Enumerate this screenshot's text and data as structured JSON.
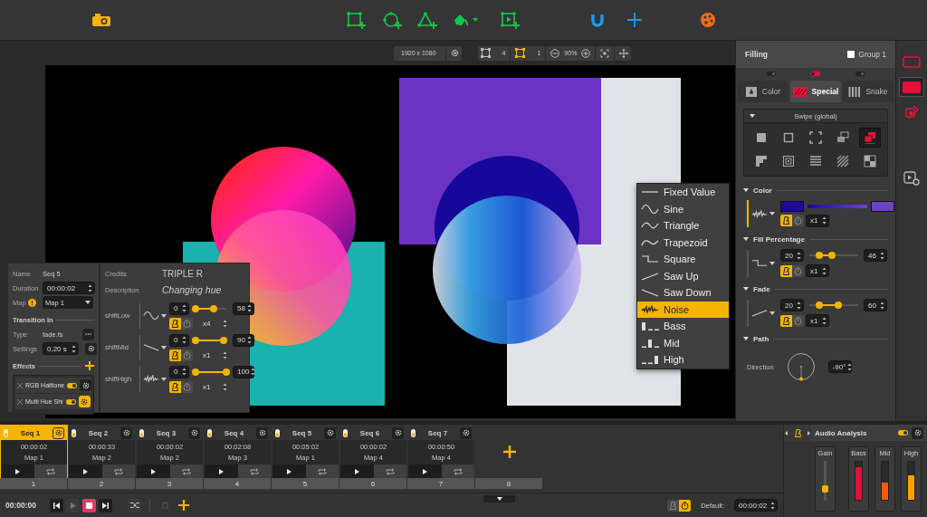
{
  "canvas_bar": {
    "resolution": "1920 x 1080",
    "shape_count": "4",
    "selected_count": "1",
    "zoom": "90%"
  },
  "sequence_panel": {
    "name_label": "Name",
    "name": "Seq 5",
    "duration_label": "Duration",
    "duration": "00:00:02",
    "map_label": "Map",
    "map": "Map 1",
    "transition_heading": "Transition In",
    "type_label": "Type",
    "type": "fade.fs",
    "settings_label": "Settings",
    "settings": "0,20 s",
    "effects_heading": "Effects",
    "effects": [
      {
        "name": "RGB Halftone",
        "on": true,
        "selected": false
      },
      {
        "name": "Multi Hue Shi",
        "on": true,
        "selected": true
      }
    ]
  },
  "effect_panel": {
    "credits_label": "Credits",
    "credits": "TRIPLE R",
    "description_label": "Description",
    "description": "Changing hue",
    "params": [
      {
        "name": "shiftLow",
        "wave": {
          "kind": "sine"
        },
        "min": "0",
        "max": "58",
        "thumbs": [
          {
            "level": 0
          },
          {
            "level": 0.58
          }
        ],
        "beat": true,
        "multiplier": "x4"
      },
      {
        "name": "shiftMid",
        "wave": {
          "kind": "saw_down"
        },
        "min": "0",
        "max": "90",
        "thumbs": [
          {
            "level": 0
          },
          {
            "level": 0.9
          }
        ],
        "beat": true,
        "multiplier": "x1"
      },
      {
        "name": "shiftHigh",
        "wave": {
          "kind": "noise"
        },
        "min": "0",
        "max": "100",
        "thumbs": [
          {
            "level": 0
          },
          {
            "level": 1
          }
        ],
        "beat": true,
        "multiplier": "x1"
      }
    ]
  },
  "wave_menu": [
    {
      "label": "Fixed Value",
      "kind": "fixed",
      "selected": false
    },
    {
      "label": "Sine",
      "kind": "sine",
      "selected": false
    },
    {
      "label": "Triangle",
      "kind": "triangle",
      "selected": false
    },
    {
      "label": "Trapezoid",
      "kind": "trapezoid",
      "selected": false
    },
    {
      "label": "Square",
      "kind": "square",
      "selected": false
    },
    {
      "label": "Saw Up",
      "kind": "saw_up",
      "selected": false
    },
    {
      "label": "Saw Down",
      "kind": "saw_down",
      "selected": false
    },
    {
      "label": "Noise",
      "kind": "noise",
      "selected": true
    },
    {
      "label": "Bass",
      "kind": "bass",
      "selected": false
    },
    {
      "label": "Mid",
      "kind": "mid",
      "selected": false
    },
    {
      "label": "High",
      "kind": "high",
      "selected": false
    }
  ],
  "filling_panel": {
    "title": "Filling",
    "group": {
      "label": "Group 1",
      "checked": false
    },
    "page_dots": [
      {
        "selected": false
      },
      {
        "selected": true
      },
      {
        "selected": false
      }
    ],
    "tabs": [
      {
        "label": "Color",
        "kind": "color",
        "selected": false
      },
      {
        "label": "Special",
        "kind": "special",
        "selected": true
      },
      {
        "label": "Snake",
        "kind": "snake",
        "selected": false
      }
    ],
    "preset": "Swipe (global)",
    "presets": [
      {
        "kind": "solid",
        "selected": false
      },
      {
        "kind": "outline",
        "selected": false
      },
      {
        "kind": "corners",
        "selected": false
      },
      {
        "kind": "overlap",
        "selected": false
      },
      {
        "kind": "swipe",
        "selected": true
      },
      {
        "kind": "stairs",
        "selected": false
      },
      {
        "kind": "concentric",
        "selected": false
      },
      {
        "kind": "lines",
        "selected": false
      },
      {
        "kind": "hatch",
        "selected": false
      },
      {
        "kind": "checker",
        "selected": false
      }
    ],
    "sections": [
      {
        "title": "Color",
        "kind": "color",
        "selected": true,
        "wave": {
          "kind": "noise"
        },
        "colors": [
          {
            "color": "#1c0a9c"
          },
          {
            "color": "#6b44c6"
          }
        ],
        "beat": true,
        "multiplier": "x1"
      },
      {
        "title": "Fill Percentage",
        "kind": "range",
        "selected": false,
        "wave": {
          "kind": "square"
        },
        "min": "20",
        "max": "46",
        "thumbs": [
          {
            "level": 0.2
          },
          {
            "level": 0.46
          }
        ],
        "beat": true,
        "multiplier": "x1"
      },
      {
        "title": "Fade",
        "kind": "range",
        "selected": false,
        "wave": {
          "kind": "saw_up"
        },
        "min": "20",
        "max": "60",
        "thumbs": [
          {
            "level": 0.2
          },
          {
            "level": 0.6
          }
        ],
        "beat": true,
        "multiplier": "x1"
      },
      {
        "title": "Path",
        "kind": "direction",
        "label": "Direction",
        "value": "-90°"
      }
    ]
  },
  "side_tools": [
    {
      "kind": "shape",
      "selected": false
    },
    {
      "kind": "fill",
      "selected": true
    },
    {
      "kind": "effect",
      "selected": false
    },
    {
      "kind": "video",
      "selected": false
    }
  ],
  "timeline": {
    "sequences": [
      {
        "name": "Seq 1",
        "duration": "00:00:02",
        "map": "Map 1",
        "on": true,
        "selected": true
      },
      {
        "name": "Seq 2",
        "duration": "00:00:33",
        "map": "Map 2",
        "on": true,
        "selected": false
      },
      {
        "name": "Seq 3",
        "duration": "00:00:02",
        "map": "Map 2",
        "on": true,
        "selected": false
      },
      {
        "name": "Seq 4",
        "duration": "00:02:08",
        "map": "Map 3",
        "on": true,
        "selected": false
      },
      {
        "name": "Seq 5",
        "duration": "00:05:02",
        "map": "Map 1",
        "on": true,
        "selected": false
      },
      {
        "name": "Seq 6",
        "duration": "00:00:02",
        "map": "Map 4",
        "on": true,
        "selected": false
      },
      {
        "name": "Seq 7",
        "duration": "00:00:50",
        "map": "Map 4",
        "on": true,
        "selected": false
      }
    ],
    "slots": [
      "1",
      "2",
      "3",
      "4",
      "5",
      "6",
      "7",
      "8"
    ],
    "time": "00:00:00",
    "beat": false,
    "default_label": "Default:",
    "default": "00:00:02"
  },
  "audio": {
    "title": "Audio Analysis",
    "on": true,
    "channels": [
      {
        "name": "Gain",
        "kind": "slider",
        "level": 0.3
      },
      {
        "name": "Bass",
        "kind": "meter",
        "level": 0.85,
        "color": "#e0103a"
      },
      {
        "name": "Mid",
        "kind": "meter",
        "level": 0.45,
        "color": "#ff5a0a"
      },
      {
        "name": "High",
        "kind": "meter",
        "level": 0.65,
        "color": "#ffa000"
      }
    ]
  }
}
